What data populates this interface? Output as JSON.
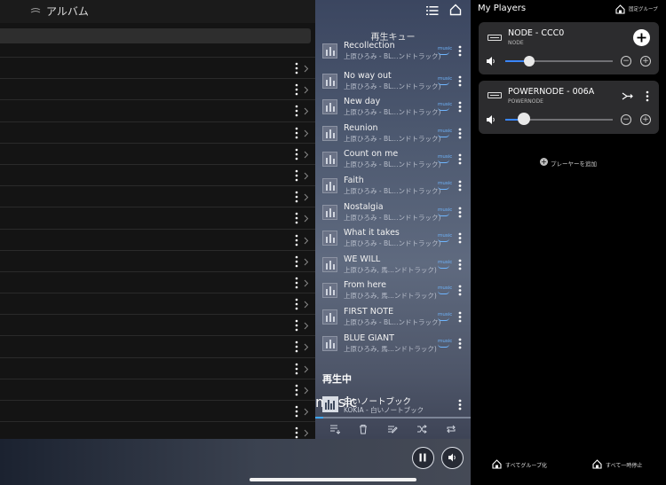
{
  "album_panel": {
    "title": "アルバム",
    "row_count": 18
  },
  "queue": {
    "title": "再生キュー",
    "source_badge": "music",
    "items": [
      {
        "title": "Recollection",
        "subtitle": "上原ひろみ - BL...ンドトラック)"
      },
      {
        "title": "No way out",
        "subtitle": "上原ひろみ - BL...ンドトラック)"
      },
      {
        "title": "New day",
        "subtitle": "上原ひろみ - BL...ンドトラック)"
      },
      {
        "title": "Reunion",
        "subtitle": "上原ひろみ - BL...ンドトラック)"
      },
      {
        "title": "Count on me",
        "subtitle": "上原ひろみ - BL...ンドトラック)"
      },
      {
        "title": "Faith",
        "subtitle": "上原ひろみ - BL...ンドトラック)"
      },
      {
        "title": "Nostalgia",
        "subtitle": "上原ひろみ - BL...ンドトラック)"
      },
      {
        "title": "What it takes",
        "subtitle": "上原ひろみ - BL...ンドトラック)"
      },
      {
        "title": "WE WILL",
        "subtitle": "上原ひろみ, 馬...ンドトラック)"
      },
      {
        "title": "From here",
        "subtitle": "上原ひろみ, 馬...ンドトラック)"
      },
      {
        "title": "FIRST NOTE",
        "subtitle": "上原ひろみ - BL...ンドトラック)"
      },
      {
        "title": "BLUE GIANT",
        "subtitle": "上原ひろみ, 馬...ンドトラック)"
      }
    ],
    "now_playing_label": "再生中",
    "now_playing": {
      "title": "白いノートブック",
      "subtitle": "KOKIA - 白いノートブック"
    },
    "progress": 0.05
  },
  "players": {
    "title": "My Players",
    "fixed_group_label": "固定グループ",
    "cards": [
      {
        "name": "NODE - CCC0",
        "model": "NODE",
        "volume": 0.22
      },
      {
        "name": "POWERNODE - 006A",
        "model": "POWERNODE",
        "volume": 0.17
      }
    ],
    "add_player_label": "プレーヤーを追加",
    "group_all_label": "すべてグループ化",
    "pause_all_label": "すべて一時停止"
  },
  "colors": {
    "accent": "#3a86ff",
    "card_bg": "#2c2c2e",
    "queue_bg": "#4c586f"
  }
}
